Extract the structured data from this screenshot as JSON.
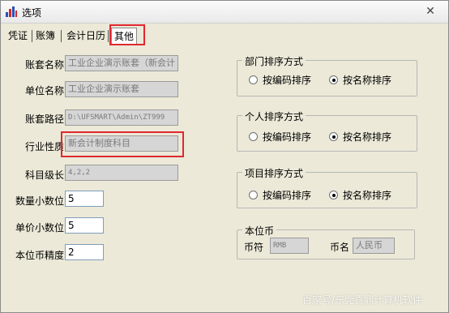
{
  "window": {
    "title": "选项",
    "close_glyph": "✕"
  },
  "tabs": [
    {
      "label": "凭证"
    },
    {
      "label": "账簿"
    },
    {
      "label": "会计日历"
    },
    {
      "label": "其他"
    }
  ],
  "left_fields": {
    "account_set_name": {
      "label": "账套名称",
      "value": "工业企业演示账套（新会计"
    },
    "company_name": {
      "label": "单位名称",
      "value": "工业企业演示账套"
    },
    "account_path": {
      "label": "账套路径",
      "value": "D:\\UFSMART\\Admin\\ZT999"
    },
    "industry": {
      "label": "行业性质",
      "value": "新会计制度科目"
    },
    "subject_levels": {
      "label": "科目级长",
      "value": "4,2,2"
    },
    "qty_decimals": {
      "label": "数量小数位",
      "value": "5"
    },
    "price_decimals": {
      "label": "单价小数位",
      "value": "5"
    },
    "currency_precision": {
      "label": "本位币精度",
      "value": "2"
    }
  },
  "groups": {
    "department_sort": {
      "title": "部门排序方式",
      "options": [
        {
          "label": "按编码排序",
          "selected": false
        },
        {
          "label": "按名称排序",
          "selected": true
        }
      ]
    },
    "personal_sort": {
      "title": "个人排序方式",
      "options": [
        {
          "label": "按编码排序",
          "selected": false
        },
        {
          "label": "按名称排序",
          "selected": true
        }
      ]
    },
    "project_sort": {
      "title": "项目排序方式",
      "options": [
        {
          "label": "按编码排序",
          "selected": false
        },
        {
          "label": "按名称排序",
          "selected": true
        }
      ]
    },
    "base_currency": {
      "title": "本位币",
      "symbol_label": "币符",
      "symbol_value": "RMB",
      "name_label": "币名",
      "name_value": "人民币"
    }
  },
  "watermark": "百家号/东莞喜鼎计算机软件",
  "highlight_color": "#e0282f"
}
